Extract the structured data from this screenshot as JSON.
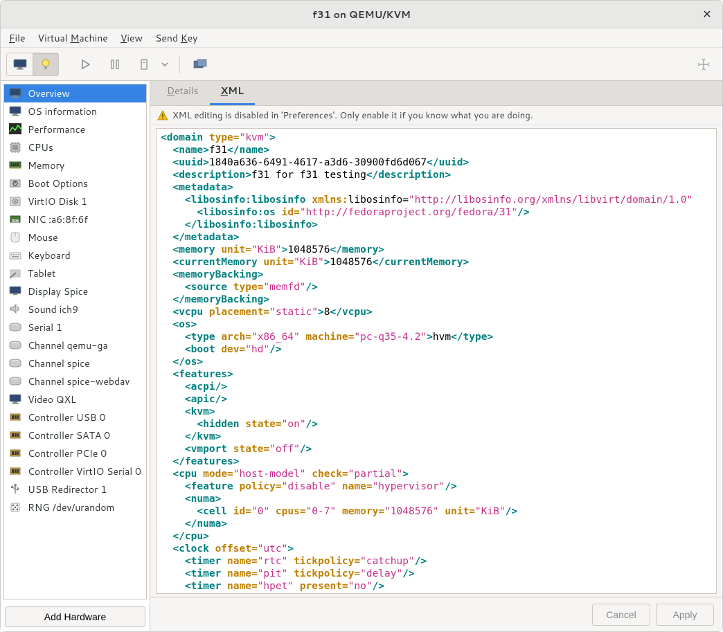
{
  "window": {
    "title": "f31 on QEMU/KVM"
  },
  "menubar": {
    "file": "File",
    "vm": "Virtual Machine",
    "view": "View",
    "sendkey": "Send Key"
  },
  "sidebar": {
    "items": [
      {
        "label": "Overview",
        "icon": "monitor"
      },
      {
        "label": "OS information",
        "icon": "monitor"
      },
      {
        "label": "Performance",
        "icon": "chart"
      },
      {
        "label": "CPUs",
        "icon": "cpu"
      },
      {
        "label": "Memory",
        "icon": "ram"
      },
      {
        "label": "Boot Options",
        "icon": "boot"
      },
      {
        "label": "VirtIO Disk 1",
        "icon": "disk"
      },
      {
        "label": "NIC :a6:8f:6f",
        "icon": "nic"
      },
      {
        "label": "Mouse",
        "icon": "mouse"
      },
      {
        "label": "Keyboard",
        "icon": "keyboard"
      },
      {
        "label": "Tablet",
        "icon": "tablet"
      },
      {
        "label": "Display Spice",
        "icon": "display"
      },
      {
        "label": "Sound ich9",
        "icon": "sound"
      },
      {
        "label": "Serial 1",
        "icon": "serial"
      },
      {
        "label": "Channel qemu-ga",
        "icon": "serial"
      },
      {
        "label": "Channel spice",
        "icon": "serial"
      },
      {
        "label": "Channel spice-webdav",
        "icon": "serial"
      },
      {
        "label": "Video QXL",
        "icon": "monitor"
      },
      {
        "label": "Controller USB 0",
        "icon": "controller"
      },
      {
        "label": "Controller SATA 0",
        "icon": "controller"
      },
      {
        "label": "Controller PCIe 0",
        "icon": "controller"
      },
      {
        "label": "Controller VirtIO Serial 0",
        "icon": "controller"
      },
      {
        "label": "USB Redirector 1",
        "icon": "usb"
      },
      {
        "label": "RNG /dev/urandom",
        "icon": "rng"
      }
    ],
    "add_hw": "Add Hardware"
  },
  "tabs": {
    "details": "Details",
    "xml": "XML"
  },
  "warning": "XML editing is disabled in 'Preferences'. Only enable it if you know what you are doing.",
  "footer": {
    "cancel": "Cancel",
    "apply": "Apply"
  },
  "xml_data": {
    "domain_type": "kvm",
    "name": "f31",
    "uuid": "1840a636-6491-4617-a3d6-30900fd6d067",
    "description": "f31 for f31 testing",
    "libosinfo_xmlns": "http://libosinfo.org/xmlns/libvirt/domain/1.0",
    "libosinfo_os_id": "http://fedoraproject.org/fedora/31",
    "memory_unit": "KiB",
    "memory": "1048576",
    "currentMemory_unit": "KiB",
    "currentMemory": "1048576",
    "memoryBacking_source_type": "memfd",
    "vcpu_placement": "static",
    "vcpu": "8",
    "os_type_arch": "x86_64",
    "os_type_machine": "pc-q35-4.2",
    "os_type": "hvm",
    "boot_dev": "hd",
    "kvm_hidden_state": "on",
    "vmport_state": "off",
    "cpu_mode": "host-model",
    "cpu_check": "partial",
    "cpu_feature_policy": "disable",
    "cpu_feature_name": "hypervisor",
    "numa_cell_id": "0",
    "numa_cell_cpus": "0-7",
    "numa_cell_memory": "1048576",
    "numa_cell_unit": "KiB",
    "clock_offset": "utc",
    "timer_rtc_tickpolicy": "catchup",
    "timer_pit_tickpolicy": "delay",
    "timer_hpet_present": "no"
  }
}
